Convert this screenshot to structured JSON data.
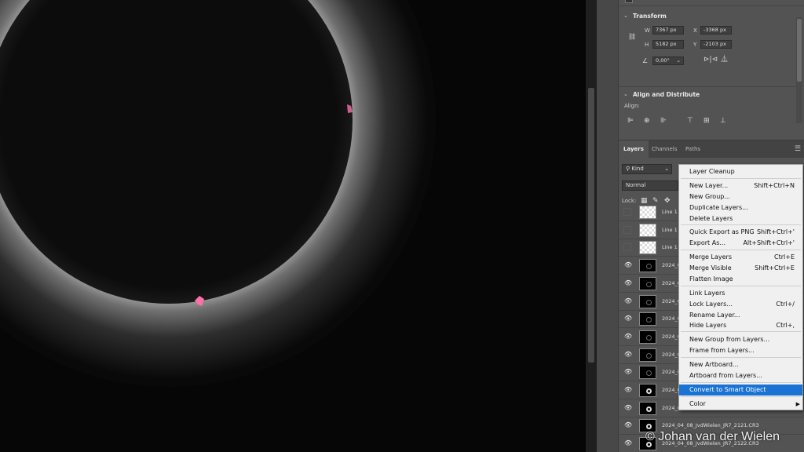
{
  "properties": {
    "transform": {
      "title": "Transform",
      "w_label": "W",
      "w_value": "7367 px",
      "h_label": "H",
      "h_value": "5182 px",
      "x_label": "X",
      "x_value": "-3368 px",
      "y_label": "Y",
      "y_value": "-2103 px",
      "angle_value": "0,00°"
    },
    "align": {
      "title": "Align and Distribute",
      "align_label": "Align:"
    }
  },
  "layers_panel": {
    "tabs": [
      "Layers",
      "Channels",
      "Paths"
    ],
    "filter_kind": "Kind",
    "blend_mode": "Normal",
    "lock_label": "Lock:",
    "rows": [
      {
        "name": "Line 1",
        "visible": false,
        "thumb": "checker"
      },
      {
        "name": "Line 1",
        "visible": false,
        "thumb": "checker"
      },
      {
        "name": "Line 1",
        "visible": false,
        "thumb": "checker"
      },
      {
        "name": "2024_0",
        "visible": true,
        "thumb": "dark"
      },
      {
        "name": "2024_0",
        "visible": true,
        "thumb": "dark"
      },
      {
        "name": "2024_0",
        "visible": true,
        "thumb": "dark"
      },
      {
        "name": "2024_0",
        "visible": true,
        "thumb": "dark"
      },
      {
        "name": "2024_0",
        "visible": true,
        "thumb": "dark"
      },
      {
        "name": "2024_0",
        "visible": true,
        "thumb": "dark"
      },
      {
        "name": "2024_0",
        "visible": true,
        "thumb": "dark"
      },
      {
        "name": "2024_0",
        "visible": true,
        "thumb": "bright"
      },
      {
        "name": "2024_0",
        "visible": true,
        "thumb": "bright"
      },
      {
        "name": "2024_04_08_JvdWielen_JR7_2121.CR3",
        "visible": true,
        "thumb": "bright"
      },
      {
        "name": "2024_04_08_JvdWielen_JR7_2122.CR3",
        "visible": true,
        "thumb": "bright"
      }
    ]
  },
  "context_menu": {
    "items": [
      {
        "label": "Layer Cleanup",
        "shortcut": ""
      },
      {
        "label": "New Layer...",
        "shortcut": "Shift+Ctrl+N"
      },
      {
        "label": "New Group...",
        "shortcut": ""
      },
      {
        "label": "Duplicate Layers...",
        "shortcut": ""
      },
      {
        "label": "Delete Layers",
        "shortcut": ""
      },
      {
        "label": "Quick Export as PNG",
        "shortcut": "Shift+Ctrl+'"
      },
      {
        "label": "Export As...",
        "shortcut": "Alt+Shift+Ctrl+'"
      },
      {
        "label": "Merge Layers",
        "shortcut": "Ctrl+E"
      },
      {
        "label": "Merge Visible",
        "shortcut": "Shift+Ctrl+E"
      },
      {
        "label": "Flatten Image",
        "shortcut": ""
      },
      {
        "label": "Link Layers",
        "shortcut": ""
      },
      {
        "label": "Lock Layers...",
        "shortcut": "Ctrl+/"
      },
      {
        "label": "Rename Layer...",
        "shortcut": ""
      },
      {
        "label": "Hide Layers",
        "shortcut": "Ctrl+,"
      },
      {
        "label": "New Group from Layers...",
        "shortcut": ""
      },
      {
        "label": "Frame from Layers...",
        "shortcut": ""
      },
      {
        "label": "New Artboard...",
        "shortcut": ""
      },
      {
        "label": "Artboard from Layers...",
        "shortcut": ""
      },
      {
        "label": "Convert to Smart Object",
        "shortcut": "",
        "selected": true
      },
      {
        "label": "Color",
        "shortcut": "",
        "submenu": true
      }
    ]
  },
  "watermark": "© Johan van der Wielen",
  "colors": {
    "panel_bg": "#535353",
    "menu_highlight": "#1a73d4",
    "prominence": "#ff6fa8"
  }
}
